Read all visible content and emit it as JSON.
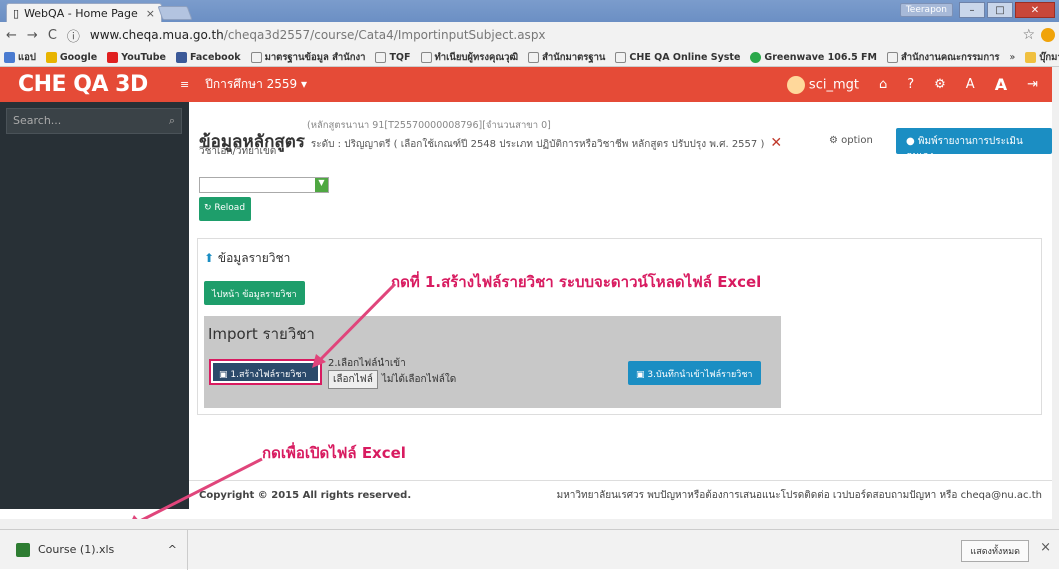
{
  "browser": {
    "tab_title": "WebQA - Home Page",
    "tab_close": "×",
    "user": "Teerapon",
    "url_host": "www.cheqa.mua.go.th",
    "url_path": "/cheqa3d2557/course/Cata4/ImportinputSubject.aspx",
    "bookmarks": [
      "แอป",
      "Google",
      "YouTube",
      "Facebook",
      "มาตรฐานข้อมูล สำนักงา",
      "TQF",
      "ทำเนียบผู้ทรงคุณวุฒิ",
      "สำนักมาตรฐาน",
      "CHE QA Online Syste",
      "Greenwave 106.5 FM",
      "สำนักงานคณะกรรมการ",
      "»",
      "บุ๊กมาร์กอื่นๆ"
    ],
    "colors": {
      "brand": "#e54b37",
      "accent": "#d81b60"
    }
  },
  "navbar": {
    "logo": "CHE QA 3D",
    "year_label": "ปีการศึกษา 2559",
    "user": "sci_mgt"
  },
  "sidebar": {
    "search_placeholder": "Search...",
    "search_icon": "magnifier"
  },
  "header": {
    "title": "ข้อมูลหลักสูตร",
    "meta": "(หลักสูตรนานา 91[T25570000008796][จำนวนสาขา 0]",
    "detail": "ระดับ : ปริญญาตรี ( เลือกใช้เกณฑ์ปี 2548 ประเภท ปฏิบัติการหรือวิชาชีพ หลักสูตร ปรับปรุง พ.ศ. 2557 )",
    "sub": "วิชาเอก/วิทยาเขต",
    "option": "option",
    "report_button": "พิมพ์รายงานการประเมินตนเอง",
    "reload": "Reload"
  },
  "panel": {
    "title": "ข้อมูลรายวิชา",
    "goto_button": "ไปหน้า ข้อมูลรายวิชา",
    "import_title": "Import รายวิชา",
    "step1_button": "1.สร้างไฟล์รายวิชา",
    "step2_label": "2.เลือกไฟล์นำเข้า",
    "choose_button": "เลือกไฟล์",
    "no_file": "ไม่ได้เลือกไฟล์ใด",
    "step3_button": "3.บันทึกนำเข้าไฟล์รายวิชา"
  },
  "annotations": {
    "a1": "กดที่ 1.สร้างไฟล์รายวิชา ระบบจะดาวน์โหลดไฟล์ Excel",
    "a2": "กดเพื่อเปิดไฟล์ Excel"
  },
  "footer": {
    "left": "Copyright © 2015 All rights reserved.",
    "right": "มหาวิทยาลัยนเรศวร พบปัญหาหรือต้องการเสนอแนะโปรดติดต่อ เวปบอร์ดสอบถามปัญหา หรือ cheqa@nu.ac.th"
  },
  "downloads": {
    "file": "Course (1).xls",
    "show_all": "แสดงทั้งหมด",
    "close": "×"
  }
}
